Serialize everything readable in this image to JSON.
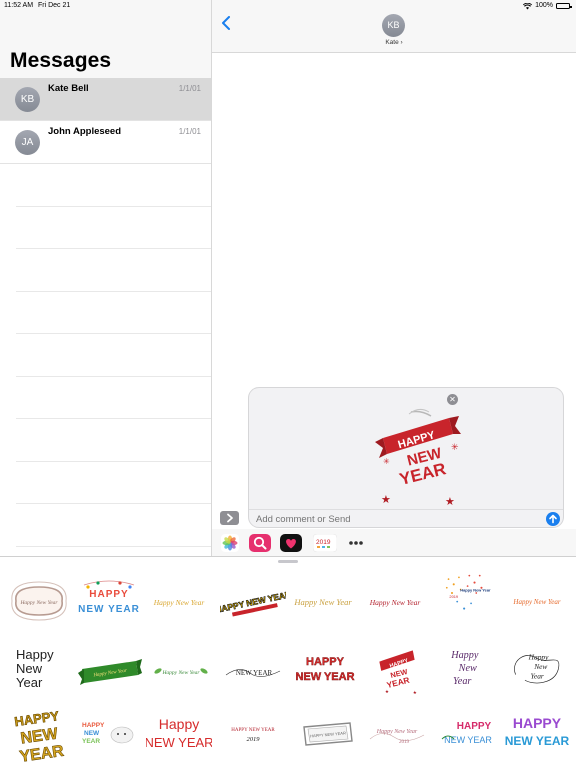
{
  "status_bar": {
    "time": "11:52 AM",
    "date": "Fri Dec 21",
    "battery": "100%"
  },
  "sidebar": {
    "title": "Messages",
    "conversations": [
      {
        "initials": "KB",
        "name": "Kate Bell",
        "date": "1/1/01"
      },
      {
        "initials": "JA",
        "name": "John Appleseed",
        "date": "1/1/01"
      }
    ]
  },
  "header": {
    "initials": "KB",
    "name": "Kate"
  },
  "compose": {
    "placeholder": "Add comment or Send"
  },
  "stickers": {
    "preview_text": [
      "HAPPY",
      "NEW",
      "YEAR"
    ],
    "row1": [
      "Happy New Year",
      "HAPPY",
      "NEW YEAR",
      "Happy New Year",
      "HAPPY NEW YEAR",
      "Happy New Year",
      "Happy New Year",
      "Happy New Year",
      "Happy New Year"
    ],
    "happy_new_year_lines": [
      "Happy",
      "New",
      "Year"
    ],
    "year_2019": "2019"
  },
  "colors": {
    "accent": "#1a7fee",
    "avatar": "#8e929b",
    "sticker_red": "#c8242b"
  }
}
